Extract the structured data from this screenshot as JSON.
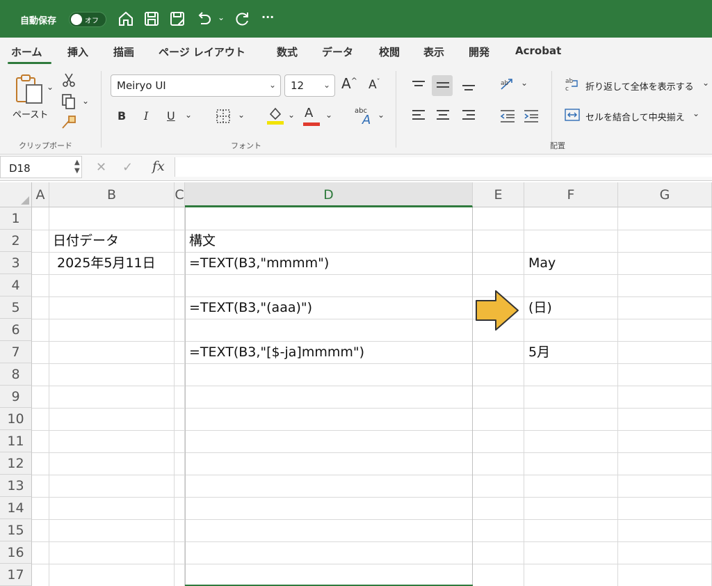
{
  "titlebar": {
    "autosave_label": "自動保存",
    "toggle_text": "オフ",
    "icons": [
      "home-icon",
      "save-icon",
      "save-as-icon",
      "undo-icon",
      "redo-icon",
      "more-icon"
    ],
    "more_glyph": "···"
  },
  "tabs": [
    {
      "label": "ホーム",
      "active": true
    },
    {
      "label": "挿入"
    },
    {
      "label": "描画"
    },
    {
      "label": "ページ レイアウト"
    },
    {
      "label": "数式"
    },
    {
      "label": "データ"
    },
    {
      "label": "校閲"
    },
    {
      "label": "表示"
    },
    {
      "label": "開発"
    },
    {
      "label": "Acrobat"
    }
  ],
  "ribbon": {
    "clipboard": {
      "paste_label": "ペースト",
      "group_label": "クリップボード"
    },
    "font": {
      "name": "Meiryo UI",
      "size": "12",
      "bold": "B",
      "italic": "I",
      "underline": "U",
      "grow": "A",
      "shrink": "A",
      "color_letter": "A",
      "phonetic": "abc",
      "group_label": "フォント",
      "highlight_color": "#f2e300",
      "font_color": "#e03a2e"
    },
    "alignment": {
      "wrap_label": "折り返して全体を表示する",
      "merge_label": "セルを結合して中央揃え",
      "group_label": "配置"
    }
  },
  "formula_bar": {
    "name_box": "D18",
    "cancel": "✕",
    "confirm": "✓",
    "fx": "fx",
    "content": ""
  },
  "sheet": {
    "columns": [
      "A",
      "B",
      "C",
      "D",
      "E",
      "F",
      "G"
    ],
    "active_column": "D",
    "rows": [
      "1",
      "2",
      "3",
      "4",
      "5",
      "6",
      "7",
      "8",
      "9",
      "10",
      "11",
      "12",
      "13",
      "14",
      "15",
      "16",
      "17"
    ],
    "cells": {
      "B2": "日付データ",
      "B3": "2025年5月11日",
      "D2": "構文",
      "D3": "=TEXT(B3,\"mmmm\")",
      "D5": "=TEXT(B3,\"(aaa)\")",
      "D7": "=TEXT(B3,\"[$-ja]mmmm\")",
      "F3": "May",
      "F5": "(日)",
      "F7": "5月"
    },
    "arrow_color": "#f0b93a"
  }
}
